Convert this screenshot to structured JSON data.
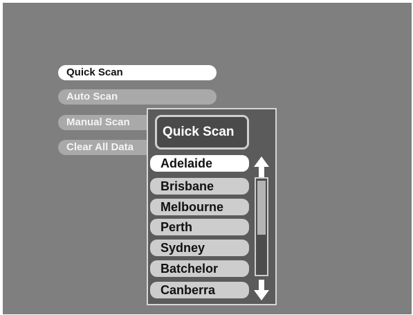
{
  "main_menu": {
    "items": [
      {
        "label": "Quick Scan",
        "state": "selected"
      },
      {
        "label": "Auto Scan",
        "state": "normal"
      },
      {
        "label": "Manual Scan",
        "state": "normal"
      },
      {
        "label": "Clear All Data",
        "state": "normal"
      }
    ]
  },
  "popup": {
    "title": "Quick Scan",
    "cities": [
      "Adelaide",
      "Brisbane",
      "Melbourne",
      "Perth",
      "Sydney",
      "Batchelor",
      "Canberra"
    ],
    "selected_index": 0,
    "scroll_up_icon": "arrow-up-icon",
    "scroll_down_icon": "arrow-down-icon"
  },
  "colors": {
    "background": "#7f7f7f",
    "selected_item": "#ffffff",
    "inactive_menu_item": "#a9a9a9",
    "inactive_city_item": "#cdcdcd",
    "popup_background": "#5b5b5b"
  }
}
